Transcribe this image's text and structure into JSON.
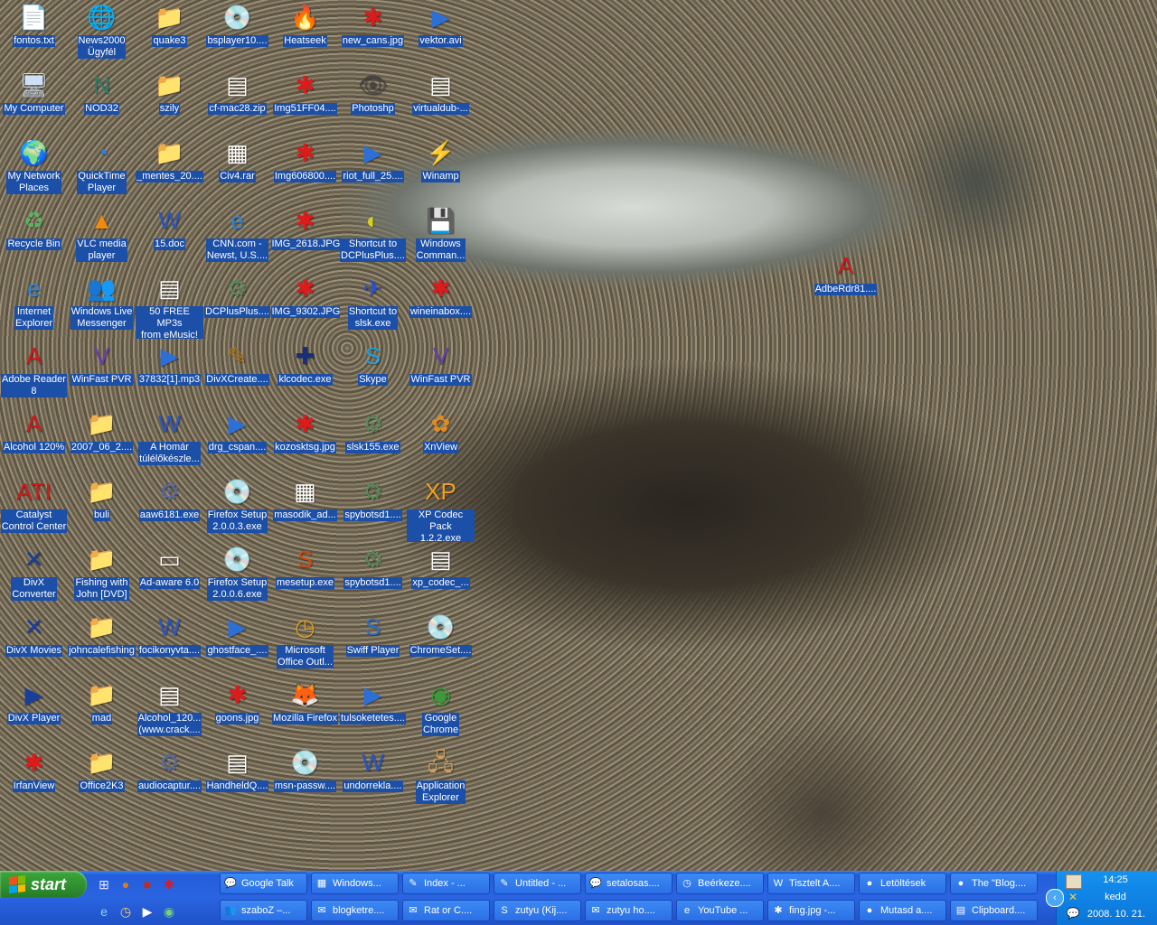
{
  "desktop": {
    "icons": [
      {
        "label": "fontos.txt",
        "icon": "text-file-icon",
        "glyph": "📄",
        "c": "#ffffff"
      },
      {
        "label": "News2000\nÜgyfél",
        "icon": "news2000-icon",
        "glyph": "🌐",
        "c": "#1a3bd1"
      },
      {
        "label": "quake3",
        "icon": "folder-icon",
        "glyph": "📁",
        "c": "#f6d36b"
      },
      {
        "label": "bsplayer10....",
        "icon": "installer-icon",
        "glyph": "💿",
        "c": "#d9e6f2"
      },
      {
        "label": "Heatseek",
        "icon": "heatseek-icon",
        "glyph": "🔥",
        "c": "#d23a1a"
      },
      {
        "label": "new_cans.jpg",
        "icon": "irfanview-image-icon",
        "glyph": "✱",
        "c": "#e01a1a"
      },
      {
        "label": "vektor.avi",
        "icon": "media-file-icon",
        "glyph": "▶",
        "c": "#2c6fd6"
      },
      {
        "label": "My Computer",
        "icon": "my-computer-icon",
        "glyph": "🖥",
        "c": "#cfe0f5"
      },
      {
        "label": "NOD32",
        "icon": "nod32-icon",
        "glyph": "N",
        "c": "#2f7d6a"
      },
      {
        "label": "szily",
        "icon": "folder-icon",
        "glyph": "📁",
        "c": "#f6d36b"
      },
      {
        "label": "cf-mac28.zip",
        "icon": "archive-icon",
        "glyph": "▤",
        "c": "#ffffff"
      },
      {
        "label": "Img51FF04....",
        "icon": "irfanview-image-icon",
        "glyph": "✱",
        "c": "#e01a1a"
      },
      {
        "label": "Photoshp",
        "icon": "photoshop-icon",
        "glyph": "👁",
        "c": "#444444"
      },
      {
        "label": "virtualdub-...",
        "icon": "archive-icon",
        "glyph": "▤",
        "c": "#ffffff"
      },
      {
        "label": "My Network\nPlaces",
        "icon": "network-places-icon",
        "glyph": "🌍",
        "c": "#3a8fd6"
      },
      {
        "label": "QuickTime\nPlayer",
        "icon": "quicktime-icon",
        "glyph": "◔",
        "c": "#2f7fe0"
      },
      {
        "label": "_mentes_20....",
        "icon": "folder-icon",
        "glyph": "📁",
        "c": "#f6d36b"
      },
      {
        "label": "Civ4.rar",
        "icon": "rar-archive-icon",
        "glyph": "▦",
        "c": "#ffffff"
      },
      {
        "label": "Img606800....",
        "icon": "irfanview-image-icon",
        "glyph": "✱",
        "c": "#e01a1a"
      },
      {
        "label": "riot_full_25....",
        "icon": "media-file-icon",
        "glyph": "▶",
        "c": "#2c6fd6"
      },
      {
        "label": "Winamp",
        "icon": "winamp-icon",
        "glyph": "⚡",
        "c": "#f0a020"
      },
      {
        "label": "Recycle Bin",
        "icon": "recycle-bin-icon",
        "glyph": "♻",
        "c": "#5fb05f"
      },
      {
        "label": "VLC media\nplayer",
        "icon": "vlc-cone-icon",
        "glyph": "▲",
        "c": "#f08a10"
      },
      {
        "label": "15.doc",
        "icon": "word-document-icon",
        "glyph": "W",
        "c": "#2a56c6"
      },
      {
        "label": "CNN.com -\nNewst, U.S....",
        "icon": "internet-shortcut-icon",
        "glyph": "e",
        "c": "#2a86e0"
      },
      {
        "label": "IMG_2618.JPG",
        "icon": "irfanview-image-icon",
        "glyph": "✱",
        "c": "#e01a1a"
      },
      {
        "label": "Shortcut to\nDCPlusPlus....",
        "icon": "dcplusplus-icon",
        "glyph": "◐",
        "c": "#d8d020"
      },
      {
        "label": "Windows\nComman...",
        "icon": "floppy-icon",
        "glyph": "💾",
        "c": "#2a3fbf"
      },
      {
        "label": "Internet\nExplorer",
        "icon": "internet-explorer-icon",
        "glyph": "e",
        "c": "#2a86e0"
      },
      {
        "label": "Windows Live\nMessenger",
        "icon": "messenger-icon",
        "glyph": "👥",
        "c": "#3fae3f"
      },
      {
        "label": "50 FREE MP3s\nfrom eMusic!",
        "icon": "shortcut-file-icon",
        "glyph": "▤",
        "c": "#ffffff"
      },
      {
        "label": "DCPlusPlus....",
        "icon": "installer-icon",
        "glyph": "⚙",
        "c": "#5a8a5a"
      },
      {
        "label": "IMG_9302.JPG",
        "icon": "irfanview-image-icon",
        "glyph": "✱",
        "c": "#e01a1a"
      },
      {
        "label": "Shortcut to\nslsk.exe",
        "icon": "soulseek-bird-icon",
        "glyph": "✈",
        "c": "#2a4fd0"
      },
      {
        "label": "wineinabox....",
        "icon": "irfanview-image-icon",
        "glyph": "✱",
        "c": "#e01a1a"
      },
      {
        "label": "Adobe Reader\n8",
        "icon": "adobe-reader-icon",
        "glyph": "A",
        "c": "#d01a1a"
      },
      {
        "label": "WinFast PVR",
        "icon": "winfast-pvr-icon",
        "glyph": "V",
        "c": "#6a3fb0"
      },
      {
        "label": "37832[1].mp3",
        "icon": "media-file-icon",
        "glyph": "▶",
        "c": "#2c6fd6"
      },
      {
        "label": "DivXCreate....",
        "icon": "divx-create-icon",
        "glyph": "✎",
        "c": "#b07a20"
      },
      {
        "label": "klcodec.exe",
        "icon": "klcodec-icon",
        "glyph": "✚",
        "c": "#1a2f7a"
      },
      {
        "label": "Skype",
        "icon": "skype-icon",
        "glyph": "S",
        "c": "#1fa0e0"
      },
      {
        "label": "WinFast PVR",
        "icon": "winfast-pvr-icon",
        "glyph": "V",
        "c": "#6a3fb0"
      },
      {
        "label": "Alcohol 120%",
        "icon": "alcohol-120-icon",
        "glyph": "A",
        "c": "#d01a1a"
      },
      {
        "label": "2007_06_2....",
        "icon": "folder-icon",
        "glyph": "📁",
        "c": "#f6d36b"
      },
      {
        "label": "A Homár\ntúlélőkészle...",
        "icon": "word-document-icon",
        "glyph": "W",
        "c": "#2a56c6"
      },
      {
        "label": "drg_cspan....",
        "icon": "media-file-icon",
        "glyph": "▶",
        "c": "#2c6fd6"
      },
      {
        "label": "kozosktsg.jpg",
        "icon": "irfanview-image-icon",
        "glyph": "✱",
        "c": "#e01a1a"
      },
      {
        "label": "slsk155.exe",
        "icon": "installer-icon",
        "glyph": "⚙",
        "c": "#5a8a5a"
      },
      {
        "label": "XnView",
        "icon": "xnview-icon",
        "glyph": "✿",
        "c": "#e08a20"
      },
      {
        "label": "Catalyst\nControl Center",
        "icon": "ati-catalyst-icon",
        "glyph": "ATI",
        "c": "#d01a1a"
      },
      {
        "label": "buli",
        "icon": "folder-icon",
        "glyph": "📁",
        "c": "#f6d36b"
      },
      {
        "label": "aaw6181.exe",
        "icon": "installer-icon",
        "glyph": "⚙",
        "c": "#5a6a9a"
      },
      {
        "label": "Firefox Setup\n2.0.0.3.exe",
        "icon": "installer-icon",
        "glyph": "💿",
        "c": "#d9e6f2"
      },
      {
        "label": "masodik_ad...",
        "icon": "rar-archive-icon",
        "glyph": "▦",
        "c": "#ffffff"
      },
      {
        "label": "spybotsd1....",
        "icon": "installer-icon",
        "glyph": "⚙",
        "c": "#5a8a5a"
      },
      {
        "label": "XP Codec Pack\n1.2.2.exe",
        "icon": "xp-codec-pack-icon",
        "glyph": "XP",
        "c": "#f0a020"
      },
      {
        "label": "DivX\nConverter",
        "icon": "divx-converter-icon",
        "glyph": "✕",
        "c": "#1a3f9a"
      },
      {
        "label": "Fishing with\nJohn [DVD]",
        "icon": "folder-icon",
        "glyph": "📁",
        "c": "#f6d36b"
      },
      {
        "label": "Ad-aware 6.0",
        "icon": "window-app-icon",
        "glyph": "▭",
        "c": "#ffffff"
      },
      {
        "label": "Firefox Setup\n2.0.0.6.exe",
        "icon": "installer-icon",
        "glyph": "💿",
        "c": "#d9e6f2"
      },
      {
        "label": "mesetup.exe",
        "icon": "mesetup-icon",
        "glyph": "S",
        "c": "#d04a10"
      },
      {
        "label": "spybotsd1....",
        "icon": "installer-icon",
        "glyph": "⚙",
        "c": "#5a8a5a"
      },
      {
        "label": "xp_codec_...",
        "icon": "archive-icon",
        "glyph": "▤",
        "c": "#ffffff"
      },
      {
        "label": "DivX Movies",
        "icon": "divx-movies-icon",
        "glyph": "✕",
        "c": "#1a3f9a"
      },
      {
        "label": "johncalefishing",
        "icon": "folder-icon",
        "glyph": "📁",
        "c": "#f6d36b"
      },
      {
        "label": "focikonyvta....",
        "icon": "word-document-icon",
        "glyph": "W",
        "c": "#2a56c6"
      },
      {
        "label": "ghostface_....",
        "icon": "media-file-icon",
        "glyph": "▶",
        "c": "#2c6fd6"
      },
      {
        "label": "Microsoft\nOffice Outl...",
        "icon": "outlook-icon",
        "glyph": "◷",
        "c": "#e0a020"
      },
      {
        "label": "Swiff Player",
        "icon": "swiff-player-icon",
        "glyph": "S",
        "c": "#2a6fd0"
      },
      {
        "label": "ChromeSet....",
        "icon": "installer-icon",
        "glyph": "💿",
        "c": "#d9e6f2"
      },
      {
        "label": "DivX Player",
        "icon": "divx-player-icon",
        "glyph": "▶",
        "c": "#1a3f9a"
      },
      {
        "label": "mad",
        "icon": "folder-icon",
        "glyph": "📁",
        "c": "#f6d36b"
      },
      {
        "label": "Alcohol_120...\n(www.crack....",
        "icon": "archive-icon",
        "glyph": "▤",
        "c": "#ffffff"
      },
      {
        "label": "goons.jpg",
        "icon": "irfanview-image-icon",
        "glyph": "✱",
        "c": "#e01a1a"
      },
      {
        "label": "Mozilla Firefox",
        "icon": "firefox-icon",
        "glyph": "🦊",
        "c": "#e07a20"
      },
      {
        "label": "tulsoketetes....",
        "icon": "media-file-icon",
        "glyph": "▶",
        "c": "#2c6fd6"
      },
      {
        "label": "Google\nChrome",
        "icon": "chrome-icon",
        "glyph": "◉",
        "c": "#3a9a3a"
      },
      {
        "label": "IrfanView",
        "icon": "irfanview-icon",
        "glyph": "✱",
        "c": "#e01a1a"
      },
      {
        "label": "Office2K3",
        "icon": "folder-icon",
        "glyph": "📁",
        "c": "#f6d36b"
      },
      {
        "label": "audiocaptur....",
        "icon": "installer-icon",
        "glyph": "⚙",
        "c": "#5a6a9a"
      },
      {
        "label": "HandheldQ....",
        "icon": "archive-icon",
        "glyph": "▤",
        "c": "#ffffff"
      },
      {
        "label": "msn-passw....",
        "icon": "installer-icon",
        "glyph": "💿",
        "c": "#d9e6f2"
      },
      {
        "label": "undorrekla....",
        "icon": "word-document-icon",
        "glyph": "W",
        "c": "#2a56c6"
      },
      {
        "label": "Application\nExplorer",
        "icon": "application-explorer-icon",
        "glyph": "🖧",
        "c": "#d0a060"
      }
    ],
    "floating_icon": {
      "label": "AdbeRdr81....",
      "icon": "adobe-reader-installer-icon",
      "glyph": "A",
      "c": "#d01a1a"
    }
  },
  "taskbar": {
    "start_label": "start",
    "quick_launch": [
      {
        "icon": "show-desktop-icon",
        "glyph": "⊞",
        "c": "#e8e8ff"
      },
      {
        "icon": "firefox-icon",
        "glyph": "●",
        "c": "#e07a20"
      },
      {
        "icon": "heatseek-icon",
        "glyph": "■",
        "c": "#c82a1a"
      },
      {
        "icon": "irfanview-icon",
        "glyph": "✱",
        "c": "#e01a1a"
      },
      {
        "icon": "internet-explorer-icon",
        "glyph": "e",
        "c": "#8fd0ff"
      },
      {
        "icon": "outlook-icon",
        "glyph": "◷",
        "c": "#ffd060"
      },
      {
        "icon": "media-player-icon",
        "glyph": "▶",
        "c": "#ffffff"
      },
      {
        "icon": "chrome-icon",
        "glyph": "◉",
        "c": "#7ad07a"
      }
    ],
    "buttons_row1": [
      {
        "label": "Google Talk",
        "icon": "google-talk-icon",
        "glyph": "💬"
      },
      {
        "label": "Windows...",
        "icon": "windows-explorer-icon",
        "glyph": "▦"
      },
      {
        "label": "Index - ...",
        "icon": "notepad-icon",
        "glyph": "✎"
      },
      {
        "label": "Untitled - ...",
        "icon": "notepad-icon",
        "glyph": "✎"
      },
      {
        "label": "setalosas....",
        "icon": "messenger-chat-icon",
        "glyph": "💬"
      },
      {
        "label": "Beérkeze....",
        "icon": "outlook-icon",
        "glyph": "◷"
      },
      {
        "label": "Tisztelt A....",
        "icon": "word-document-icon",
        "glyph": "W"
      },
      {
        "label": "Letöltések",
        "icon": "firefox-icon",
        "glyph": "●"
      },
      {
        "label": "The \"Blog....",
        "icon": "firefox-icon",
        "glyph": "●"
      }
    ],
    "buttons_row2": [
      {
        "label": "szaboZ –...",
        "icon": "messenger-icon",
        "glyph": "👥"
      },
      {
        "label": "blogketre....",
        "icon": "email-icon",
        "glyph": "✉"
      },
      {
        "label": "Rat or C....",
        "icon": "email-icon",
        "glyph": "✉"
      },
      {
        "label": "zutyu (Kij....",
        "icon": "skype-icon",
        "glyph": "S"
      },
      {
        "label": "zutyu ho....",
        "icon": "email-icon",
        "glyph": "✉"
      },
      {
        "label": "YouTube ...",
        "icon": "internet-explorer-icon",
        "glyph": "e"
      },
      {
        "label": "fing.jpg -...",
        "icon": "irfanview-icon",
        "glyph": "✱"
      },
      {
        "label": "Mutasd a....",
        "icon": "firefox-icon",
        "glyph": "●"
      },
      {
        "label": "Clipboard....",
        "icon": "clipboard-icon",
        "glyph": "▤"
      }
    ],
    "tray": {
      "time": "14:25",
      "day": "kedd",
      "date": "2008. 10. 21."
    }
  }
}
